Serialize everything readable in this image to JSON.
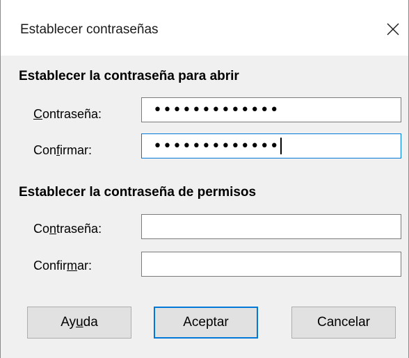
{
  "window": {
    "title": "Establecer contraseñas",
    "close_icon": "close-icon"
  },
  "open_section": {
    "title": "Establecer la contraseña para abrir",
    "password_label_pre": "",
    "password_label_mnemonic": "C",
    "password_label_post": "ontraseña:",
    "password_value": "•••••••••••••",
    "confirm_label_pre": "Con",
    "confirm_label_mnemonic": "f",
    "confirm_label_post": "irmar:",
    "confirm_value": "•••••••••••••"
  },
  "permissions_section": {
    "title": "Establecer la contraseña de permisos",
    "password_label_pre": "Co",
    "password_label_mnemonic": "n",
    "password_label_post": "traseña:",
    "password_value": "",
    "confirm_label_pre": "Confir",
    "confirm_label_mnemonic": "m",
    "confirm_label_post": "ar:",
    "confirm_value": ""
  },
  "buttons": {
    "help_pre": "Ay",
    "help_mnemonic": "u",
    "help_post": "da",
    "ok": "Aceptar",
    "cancel": "Cancelar"
  },
  "colors": {
    "focus_accent": "#0078d7",
    "dialog_background": "#f0f0f0"
  }
}
